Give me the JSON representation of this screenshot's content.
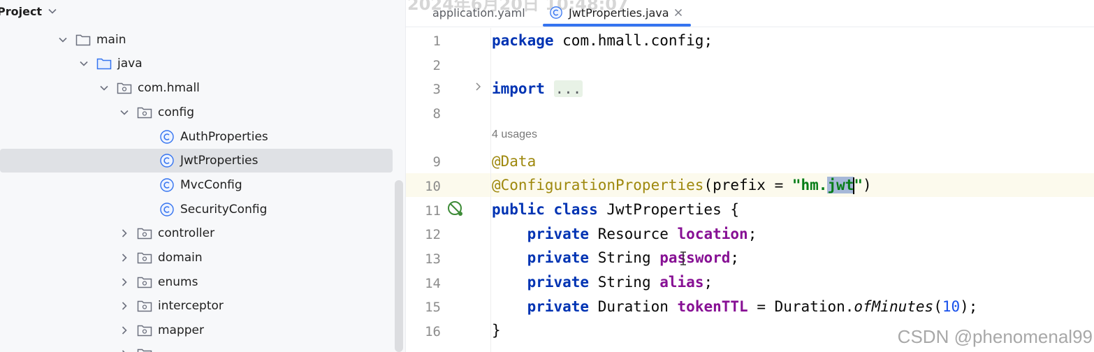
{
  "project_panel": {
    "title": "Project",
    "tree": [
      {
        "label": "main",
        "type": "folder",
        "expanded": true
      },
      {
        "label": "java",
        "type": "source-folder",
        "expanded": true
      },
      {
        "label": "com.hmall",
        "type": "package",
        "expanded": true
      },
      {
        "label": "config",
        "type": "package",
        "expanded": true
      },
      {
        "label": "AuthProperties",
        "type": "class"
      },
      {
        "label": "JwtProperties",
        "type": "class",
        "selected": true
      },
      {
        "label": "MvcConfig",
        "type": "class"
      },
      {
        "label": "SecurityConfig",
        "type": "class"
      },
      {
        "label": "controller",
        "type": "package",
        "expanded": false
      },
      {
        "label": "domain",
        "type": "package",
        "expanded": false
      },
      {
        "label": "enums",
        "type": "package",
        "expanded": false
      },
      {
        "label": "interceptor",
        "type": "package",
        "expanded": false
      },
      {
        "label": "mapper",
        "type": "package",
        "expanded": false
      }
    ]
  },
  "tabs": [
    {
      "label": "application.yaml",
      "active": false
    },
    {
      "label": "JwtProperties.java",
      "active": true
    }
  ],
  "watermark_top": "2024年6月20日 10:48:07",
  "watermark_bottom": "CSDN @phenomenal99",
  "usages_hint": "4 usages",
  "line_numbers": [
    "1",
    "2",
    "3",
    "8",
    "9",
    "10",
    "11",
    "12",
    "13",
    "14",
    "15",
    "16"
  ],
  "code": {
    "l1_kw": "package",
    "l1_rest": " com.hmall.config;",
    "l3_kw": "import",
    "l3_fold": "...",
    "l9_ann": "@Data",
    "l10_ann": "@ConfigurationProperties",
    "l10_open": "(prefix = ",
    "l10_str_a": "\"hm.",
    "l10_str_sel": "jwt",
    "l10_str_b": "\"",
    "l10_close": ")",
    "l11_kw": "public class",
    "l11_rest": " JwtProperties {",
    "private_kw": "private",
    "l12_type": " Resource ",
    "l12_field": "location",
    "l13_type": " String ",
    "l13_field": "password",
    "l14_type": " String ",
    "l14_field": "alias",
    "l15_type": " Duration ",
    "l15_field": "tokenTTL",
    "l15_mid": " = Duration.",
    "l15_method": "ofMinutes",
    "l15_paren_open": "(",
    "l15_num": "10",
    "l15_paren_close": ");",
    "semicolon": ";",
    "l16": "}"
  },
  "colors": {
    "keyword": "#0033b3",
    "annotation": "#9e880d",
    "string": "#067d17",
    "field": "#871094",
    "number": "#1750eb",
    "tab_underline": "#3574f0"
  }
}
